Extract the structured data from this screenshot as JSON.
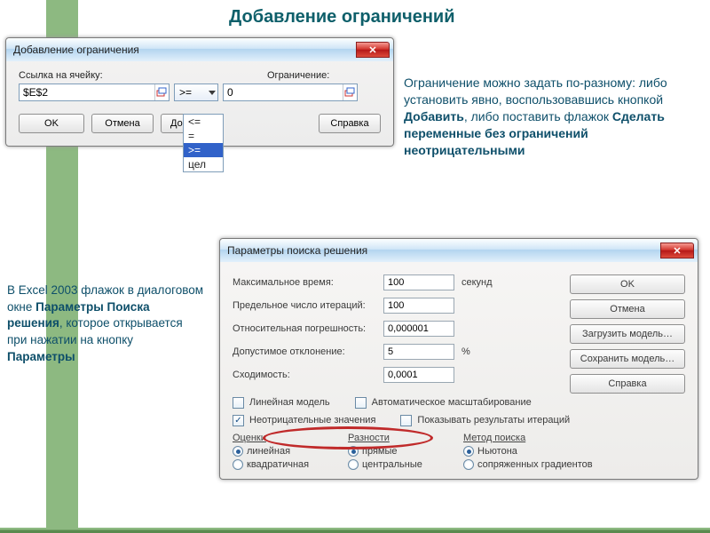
{
  "title": "Добавление ограничений",
  "para1": {
    "t1": "Ограничение можно задать по-разному: либо установить явно, воспользовавшись кнопкой ",
    "b1": "Добавить",
    "t2": ", либо поставить флажок ",
    "b2": "Сделать переменные без ограничений неотрицательными"
  },
  "para2": {
    "t1": "В Excel 2003 флажок в диалоговом окне ",
    "b1": "Параметры Поиска решения",
    "t2": ", которое открывается при нажатии на кнопку ",
    "b2": "Параметры"
  },
  "dialog1": {
    "title": "Добавление ограничения",
    "labels": {
      "cellref": "Ссылка на ячейку:",
      "constraint": "Ограничение:"
    },
    "cellref_value": "$E$2",
    "op_selected": ">=",
    "constraint_value": "0",
    "dropdown": [
      "<=",
      "=",
      ">=",
      "цел"
    ],
    "dropdown_selected": ">=",
    "buttons": {
      "ok": "OK",
      "cancel": "Отмена",
      "add": "Добавить",
      "help": "Справка"
    }
  },
  "dialog2": {
    "title": "Параметры поиска решения",
    "rows": {
      "maxtime": {
        "label": "Максимальное время:",
        "value": "100",
        "unit": "секунд"
      },
      "iter": {
        "label": "Предельное число итераций:",
        "value": "100",
        "unit": ""
      },
      "prec": {
        "label": "Относительная погрешность:",
        "value": "0,000001",
        "unit": ""
      },
      "tol": {
        "label": "Допустимое отклонение:",
        "value": "5",
        "unit": "%"
      },
      "conv": {
        "label": "Сходимость:",
        "value": "0,0001",
        "unit": ""
      }
    },
    "buttons": {
      "ok": "OK",
      "cancel": "Отмена",
      "load": "Загрузить модель…",
      "save": "Сохранить модель…",
      "help": "Справка"
    },
    "checks": {
      "linear": "Линейная модель",
      "autoscale": "Автоматическое масштабирование",
      "nonneg": "Неотрицательные значения",
      "showiter": "Показывать результаты итераций"
    },
    "groups": {
      "eval": {
        "hdr": "Оценки",
        "opt1": "линейная",
        "opt2": "квадратичная"
      },
      "diff": {
        "hdr": "Разности",
        "opt1": "прямые",
        "opt2": "центральные"
      },
      "method": {
        "hdr": "Метод поиска",
        "opt1": "Ньютона",
        "opt2": "сопряженных градиентов"
      }
    }
  }
}
